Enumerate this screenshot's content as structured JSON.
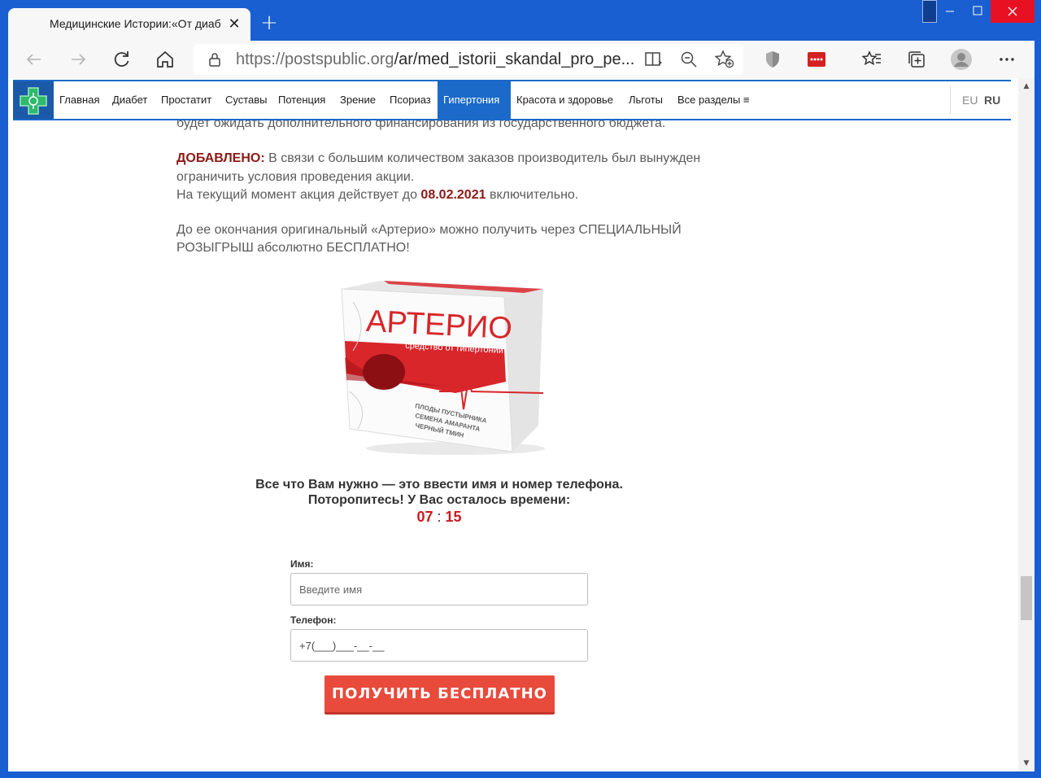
{
  "browser": {
    "tab_title": "Медицинские Истории:«От диабета",
    "url_host": "https://postspublic.org",
    "url_path": "/ar/med_istorii_skandal_pro_pe..."
  },
  "nav": {
    "items": [
      "Главная",
      "Диабет",
      "Простатит",
      "Суставы",
      "Потенция",
      "Зрение",
      "Псориаз",
      "Гипертония",
      "Красота и здоровье",
      "Льготы",
      "Все разделы ≡"
    ],
    "active": "Гипертония",
    "lang_eu": "EU",
    "lang_ru": "RU"
  },
  "article": {
    "clipped_line": "будет ожидать дополнительного финансирования из государственного бюджета.",
    "added_label": "ДОБАВЛЕНО:",
    "added_text": " В связи с большим количеством заказов производитель был вынужден ограничить условия проведения акции.",
    "current_text": "На текущий момент акция действует до ",
    "date": "08.02.2021",
    "current_suffix": " включительно.",
    "paragraph2": "До ее окончания оригинальный «Артерио» можно получить через СПЕЦИАЛЬНЫЙ РОЗЫГРЫШ абсолютно БЕСПЛАТНО!"
  },
  "product": {
    "brand": "АРТЕРИО",
    "subtitle": "средство от гипертонии",
    "ingredients": [
      "ПЛОДЫ ПУСТЫРНИКА",
      "СЕМЕНА АМАРАНТА",
      "ЧЕРНЫЙ ТМИН"
    ],
    "accent_color": "#d8262b"
  },
  "cta": {
    "line1": "Все что Вам нужно — это ввести имя и номер телефона.",
    "line2": "Поторопитесь! У Вас осталось времени:",
    "minutes": "07",
    "seconds": "15"
  },
  "form": {
    "name_label": "Имя:",
    "name_placeholder": "Введите имя",
    "phone_label": "Телефон:",
    "phone_value": "+7(___)___-__-__",
    "submit_label": "ПОЛУЧИТЬ БЕСПЛАТНО"
  }
}
